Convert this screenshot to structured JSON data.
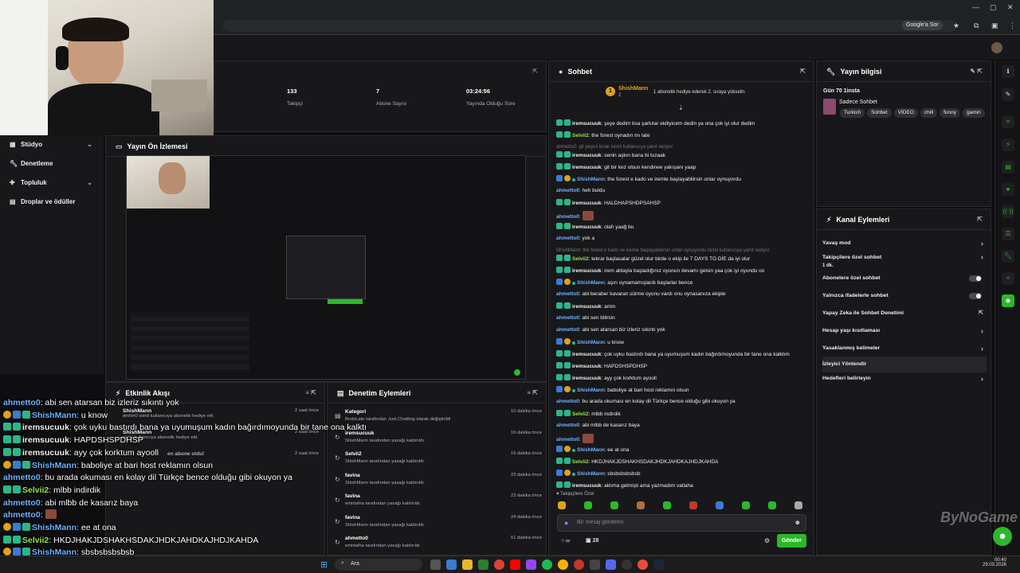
{
  "browser": {
    "search_pill": "Google'a Sor",
    "window_controls": [
      "—",
      "▢",
      "✕"
    ]
  },
  "webcam": {
    "label": "streamer webcam"
  },
  "nav": {
    "items": [
      {
        "label": "Stüdyo",
        "icon": "studio-icon",
        "has_chevron": true
      },
      {
        "label": "Denetleme",
        "icon": "wrench-icon",
        "has_chevron": false
      },
      {
        "label": "Topluluk",
        "icon": "community-icon",
        "has_chevron": true
      },
      {
        "label": "Droplar ve ödüller",
        "icon": "gift-icon",
        "has_chevron": false
      }
    ]
  },
  "stats": [
    {
      "value": "133",
      "label": "Takipçi"
    },
    {
      "value": "7",
      "label": "Abone Sayısı"
    },
    {
      "value": "03:24:56",
      "label": "Yayında Olduğu Süre"
    }
  ],
  "preview": {
    "title": "Yayın Ön İzlemesi"
  },
  "chat": {
    "title": "Sohbet",
    "pinned": {
      "user": "ShishMann",
      "count": "2",
      "text": "1 abonelik hediye ederek 2. sıraya yükselin"
    },
    "messages": [
      {
        "user": "iremsucuuk",
        "text": "şeye dedim ksa şarkılar eklilyicem dedin ya ona çok iyi olur dedim",
        "color": "#f0f0f0",
        "badges": "g"
      },
      {
        "user": "Selvii2",
        "text": "the forest oynadın mı late",
        "color": "#9be34a",
        "badges": "g"
      },
      {
        "sys": "ahmetto0: git peşini bırak isimli kullanıcıya yanıt veriyor"
      },
      {
        "user": "iremsucuuk",
        "text": "senin aşkın bana bi tuzaak",
        "color": "#f0f0f0",
        "badges": "g"
      },
      {
        "user": "iremsucuuk",
        "text": "git bir kez olsun kendinee yakışanı yaap",
        "color": "#f0f0f0",
        "badges": "g"
      },
      {
        "user": "ShishMann",
        "text": "the forest e kado ve iremle başlayabilirsin onlar oynuyordu",
        "color": "#6fb1ff",
        "badges": "b"
      },
      {
        "user": "ahmetto0",
        "text": "heh buldu",
        "color": "#6fb1ff",
        "badges": ""
      },
      {
        "user": "iremsucuuk",
        "text": "HALDHAPSHDPSAHSP",
        "color": "#f0f0f0",
        "badges": "g"
      },
      {
        "user": "ahmetto0",
        "text": "[emote]",
        "color": "#6fb1ff",
        "badges": ""
      },
      {
        "user": "iremsucuuk",
        "text": "olafı yaağ bu",
        "color": "#f0f0f0",
        "badges": "g"
      },
      {
        "user": "ahmetto0",
        "text": "yok a",
        "color": "#6fb1ff",
        "badges": ""
      },
      {
        "sys": "ShishMann: the forest e kado ve iremle başlayabilirsin onlar oynuyordu isimli kullanıcıya yanıt veriyor"
      },
      {
        "user": "Selvii2",
        "text": "tekrar başlasalar güzel olur birde o ekip ile 7 DAYS TO DİE da iyi olur",
        "color": "#9be34a",
        "badges": "g"
      },
      {
        "user": "iremsucuuk",
        "text": "irem ablayla başladığınız oyunun devamı gelsin yaa çok iyi oyundu oo",
        "color": "#f0f0f0",
        "badges": "g"
      },
      {
        "user": "ShishMann",
        "text": "aşırı oynamamışlardı başlarlar bence",
        "color": "#6fb1ff",
        "badges": "b"
      },
      {
        "user": "ahmetto0",
        "text": "abi beraber kavaran sürme oyunu vardı onu oynasanıza ekiple",
        "color": "#6fb1ff",
        "badges": ""
      },
      {
        "user": "iremsucuuk",
        "text": "amin",
        "color": "#f0f0f0",
        "badges": "g"
      },
      {
        "user": "ahmetto0",
        "text": "abi sen bilirsin",
        "color": "#6fb1ff",
        "badges": ""
      },
      {
        "user": "ahmetto0",
        "text": "abi sen atarsan biz izleriz sıkıntı yok",
        "color": "#6fb1ff",
        "badges": ""
      },
      {
        "user": "ShishMann",
        "text": "u know",
        "color": "#6fb1ff",
        "badges": "b"
      },
      {
        "user": "iremsucuuk",
        "text": "çok uyku bastırdı bana ya uyumuşum kadın bağırdımoyunda bir tane ona kalktım",
        "color": "#f0f0f0",
        "badges": "g"
      },
      {
        "user": "iremsucuuk",
        "text": "HAPDSHSPDHSP",
        "color": "#f0f0f0",
        "badges": "g"
      },
      {
        "user": "iremsucuuk",
        "text": "ayy çok korktum ayooll",
        "color": "#f0f0f0",
        "badges": "g"
      },
      {
        "user": "ShishMann",
        "text": "baboliye at bari host reklamın olsun",
        "color": "#6fb1ff",
        "badges": "b"
      },
      {
        "user": "ahmetto0",
        "text": "bu arada okuması en kolay dil Türkçe bence olduğu gibi okuyon ya",
        "color": "#6fb1ff",
        "badges": ""
      },
      {
        "user": "Selvii2",
        "text": "mlbb indirdik",
        "color": "#9be34a",
        "badges": "g"
      },
      {
        "user": "ahmetto0",
        "text": "abi mlbb de kasarız baya",
        "color": "#6fb1ff",
        "badges": ""
      },
      {
        "user": "ahmetto0",
        "text": "[emote]",
        "color": "#6fb1ff",
        "badges": ""
      },
      {
        "user": "ShishMann",
        "text": "ee at ona",
        "color": "#6fb1ff",
        "badges": "b"
      },
      {
        "user": "Selvii2",
        "text": "HKDJHAKJDSHAKHSDAKJHDKJAHDKAJHDJKAHDA",
        "color": "#9be34a",
        "badges": "g"
      },
      {
        "user": "ShishMann",
        "text": "sbsbsbsbsbsb",
        "color": "#6fb1ff",
        "badges": "b"
      },
      {
        "user": "iremsucuuk",
        "text": "aklıma gelmişti ama yazmadım vallaha",
        "color": "#f0f0f0",
        "badges": "g"
      }
    ],
    "followers_only": "Takipçilere Özel",
    "input_placeholder": "Bir mesaj gönderin",
    "points": "28",
    "send_label": "Gönder"
  },
  "stream_info": {
    "title": "Yayın bilgisi",
    "day_label": "Gün 70 1insta",
    "category": "Sadece Sohbet",
    "tags": [
      "Turkish",
      "Sohbet",
      "VİDEO",
      "chill",
      "funny",
      "gamin"
    ]
  },
  "channel_actions": {
    "title": "Kanal Eylemleri",
    "items": [
      {
        "label": "Yavaş mod",
        "control": "arrow"
      },
      {
        "label": "Takipçilere özel sohbet",
        "sub": "1 dk.",
        "control": "arrow"
      },
      {
        "label": "Abonelere özel sohbet",
        "control": "toggle"
      },
      {
        "label": "Yalnızca ifadelerle sohbet",
        "control": "toggle"
      },
      {
        "label": "Yapay Zeka ile Sohbet Denetimi",
        "control": "external"
      },
      {
        "label": "Hesap yaşı kısıtlaması",
        "control": "arrow"
      },
      {
        "label": "Yasaklanmış kelimeler",
        "control": "arrow"
      },
      {
        "label": "İzleyici Yönlendir",
        "control": "none"
      },
      {
        "label": "Hedefleri belirleyin",
        "control": "arrow"
      }
    ]
  },
  "activity": {
    "title": "Etkinlik Akışı",
    "items": [
      {
        "user": "ShishMann",
        "text": "dmNn0 isimli kullanıcıya abonelik hediye etti.",
        "time": "2 saat önce"
      },
      {
        "user": "ShishMann",
        "text": "isimli kullanıcıya abonelik hediye etti.",
        "time": "2 saat önce"
      },
      {
        "user": "",
        "text": "en abone oldu!",
        "time": "2 saat önce"
      }
    ]
  },
  "mod_actions": {
    "title": "Denetim Eylemleri",
    "items": [
      {
        "title": "Kategori",
        "sub": "BrolsLate tarafından Just Chatting olarak değiştirildi",
        "time": "10 dakika önce"
      },
      {
        "title": "iremsucuuk",
        "sub": "ShishMann tarafından yasağı kaldırıldı",
        "time": "16 dakika önce"
      },
      {
        "title": "Selvii2",
        "sub": "ShishMann tarafından yasağı kaldırıldı",
        "time": "16 dakika önce"
      },
      {
        "title": "favina",
        "sub": "ShishMann tarafından yasağı kaldırıldı",
        "time": "23 dakika önce"
      },
      {
        "title": "favina",
        "sub": "emirtalha tarafından yasağı kaldırıldı",
        "time": "23 dakika önce"
      },
      {
        "title": "favina",
        "sub": "ShishMann tarafından yasağı kaldırıldı",
        "time": "24 dakika önce"
      },
      {
        "title": "ahmetto0",
        "sub": "emirtalha tarafından yasağı kaldırıldı",
        "time": "51 dakika önce"
      }
    ]
  },
  "overlay_chat": [
    {
      "user": "ahmetto0",
      "text": "abi sen atarsan biz izleriz sıkıntı yok",
      "color": "#6fb1ff",
      "badges": ""
    },
    {
      "user": "ShishMann",
      "text": "u know",
      "color": "#6fb1ff",
      "badges": "yb"
    },
    {
      "user": "iremsucuuk",
      "text": "çok uyku bastırdı bana ya uyumuşum kadın bağırdımoyunda bir tane ona kalktı",
      "color": "#f0f0f0",
      "badges": "gg"
    },
    {
      "user": "iremsucuuk",
      "text": "HAPDSHSPDHSP",
      "color": "#f0f0f0",
      "badges": "gg"
    },
    {
      "user": "iremsucuuk",
      "text": "ayy çok korktum ayooll",
      "color": "#f0f0f0",
      "badges": "gg"
    },
    {
      "user": "ShishMann",
      "text": "baboliye at bari host reklamın olsun",
      "color": "#6fb1ff",
      "badges": "yb"
    },
    {
      "user": "ahmetto0",
      "text": "bu arada okuması en kolay dil Türkçe bence olduğu gibi okuyon ya",
      "color": "#6fb1ff",
      "badges": ""
    },
    {
      "user": "Selvii2",
      "text": "mlbb indirdik",
      "color": "#9be34a",
      "badges": "gg"
    },
    {
      "user": "ahmetto0",
      "text": "abi mlbb de kasarız baya",
      "color": "#6fb1ff",
      "badges": ""
    },
    {
      "user": "ahmetto0",
      "text": "[emote]",
      "color": "#6fb1ff",
      "badges": ""
    },
    {
      "user": "ShishMann",
      "text": "ee at ona",
      "color": "#6fb1ff",
      "badges": "yb"
    },
    {
      "user": "Selvii2",
      "text": "HKDJHAKJDSHAKHSDAKJHDKJAHDKAJHDJKAHDA",
      "color": "#9be34a",
      "badges": "gg"
    },
    {
      "user": "ShishMann",
      "text": "sbsbsbsbsbsb",
      "color": "#6fb1ff",
      "badges": "yb"
    },
    {
      "user": "iremsucuuk",
      "text": "aklıma gelmişti ama yazmadım vallaha",
      "color": "#f0f0f0",
      "badges": "gg"
    }
  ],
  "watermark": "ByNoGame",
  "taskbar": {
    "search": "Ara",
    "time": "00:40",
    "date": "29.03.2026"
  },
  "colors": {
    "accent_green": "#2bb82b",
    "panel": "#18181b",
    "bg": "#0e0e10"
  }
}
